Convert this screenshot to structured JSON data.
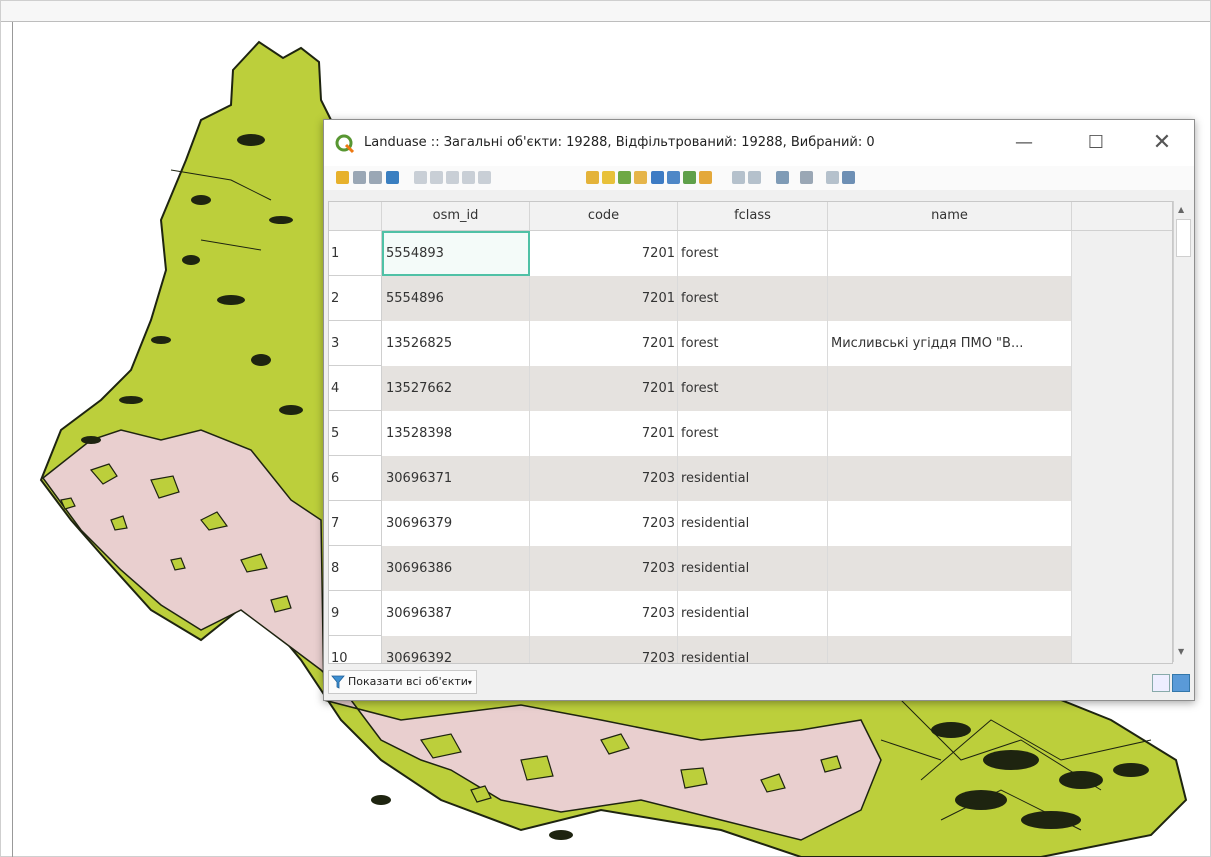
{
  "window": {
    "title": "Landuase :: Загальні об'єкти: 19288, Відфільтрований: 19288, Вибраний: 0",
    "minimize_glyph": "—",
    "maximize_glyph": "☐",
    "close_glyph": "✕"
  },
  "toolbar": {
    "icons": [
      "toggle-edit-icon",
      "save-edits-icon",
      "reload-icon",
      "refresh-icon",
      "add-feature-icon",
      "delete-feature-icon",
      "cut-icon",
      "copy-icon",
      "paste-icon",
      "select-expression-icon",
      "select-all-icon",
      "invert-selection-icon",
      "deselect-icon",
      "filter-selected-icon",
      "move-to-top-icon",
      "pan-to-selection-icon",
      "zoom-to-selection-icon",
      "new-field-icon",
      "delete-field-icon",
      "field-calculator-icon",
      "conditional-format-icon",
      "dock-icon",
      "actions-icon"
    ]
  },
  "table": {
    "columns": [
      "osm_id",
      "code",
      "fclass",
      "name"
    ],
    "rows": [
      {
        "num": "1",
        "osm_id": "5554893",
        "code": "7201",
        "fclass": "forest",
        "name": ""
      },
      {
        "num": "2",
        "osm_id": "5554896",
        "code": "7201",
        "fclass": "forest",
        "name": ""
      },
      {
        "num": "3",
        "osm_id": "13526825",
        "code": "7201",
        "fclass": "forest",
        "name": "Мисливські угіддя ПМО \"В..."
      },
      {
        "num": "4",
        "osm_id": "13527662",
        "code": "7201",
        "fclass": "forest",
        "name": ""
      },
      {
        "num": "5",
        "osm_id": "13528398",
        "code": "7201",
        "fclass": "forest",
        "name": ""
      },
      {
        "num": "6",
        "osm_id": "30696371",
        "code": "7203",
        "fclass": "residential",
        "name": ""
      },
      {
        "num": "7",
        "osm_id": "30696379",
        "code": "7203",
        "fclass": "residential",
        "name": ""
      },
      {
        "num": "8",
        "osm_id": "30696386",
        "code": "7203",
        "fclass": "residential",
        "name": ""
      },
      {
        "num": "9",
        "osm_id": "30696387",
        "code": "7203",
        "fclass": "residential",
        "name": ""
      },
      {
        "num": "10",
        "osm_id": "30696392",
        "code": "7203",
        "fclass": "residential",
        "name": ""
      }
    ]
  },
  "bottom": {
    "filter_label": "Показати всі об'єкти",
    "view_form_icon": "form-view-icon",
    "view_table_icon": "table-view-icon"
  },
  "colors": {
    "forest_fill": "#bccf3b",
    "residential_fill": "#e9cfcf",
    "outline": "#1e2410",
    "selection_border": "#4fc1a6",
    "alt_row": "#e5e2df"
  }
}
